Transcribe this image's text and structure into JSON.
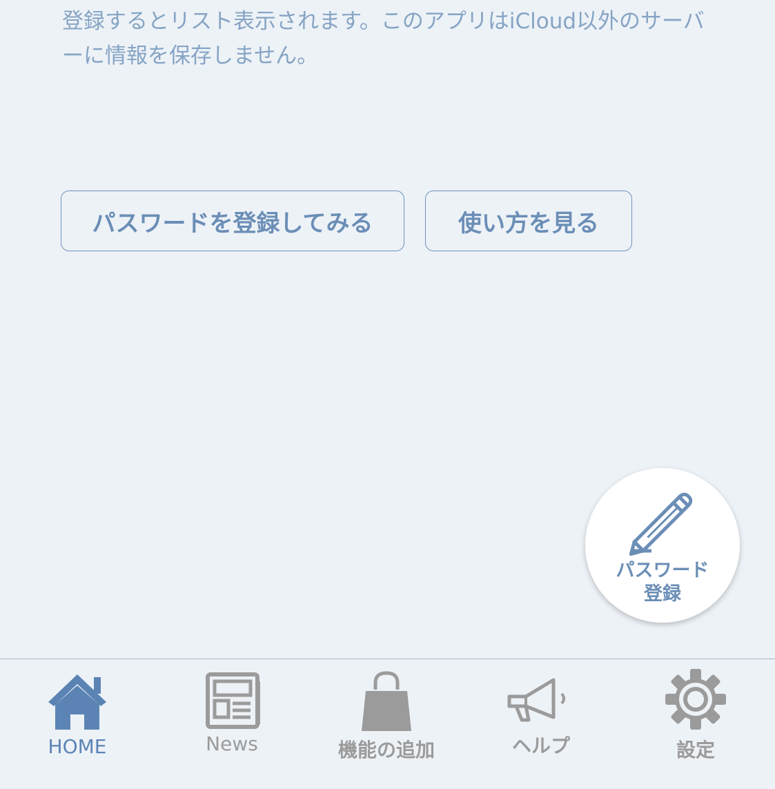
{
  "message": {
    "text": "登録するとリスト表示されます。このアプリはiCloud以外のサーバーに情報を保存しません。"
  },
  "buttons": {
    "register_label": "パスワードを登録してみる",
    "howto_label": "使い方を見る"
  },
  "fab": {
    "line1": "パスワード",
    "line2": "登録",
    "icon": "pencil-icon"
  },
  "tabbar": {
    "active_color": "#5b84b4",
    "inactive_color": "#9b9b9b",
    "tabs": [
      {
        "label": "HOME",
        "icon": "home-icon",
        "active": true
      },
      {
        "label": "News",
        "icon": "newspaper-icon",
        "active": false
      },
      {
        "label": "機能の追加",
        "icon": "shopping-bag-icon",
        "active": false
      },
      {
        "label": "ヘルプ",
        "icon": "megaphone-icon",
        "active": false
      },
      {
        "label": "設定",
        "icon": "gear-icon",
        "active": false
      }
    ]
  },
  "colors": {
    "background": "#edf2f7",
    "accent": "#6b8eb6",
    "text_muted": "#86a4c4"
  }
}
